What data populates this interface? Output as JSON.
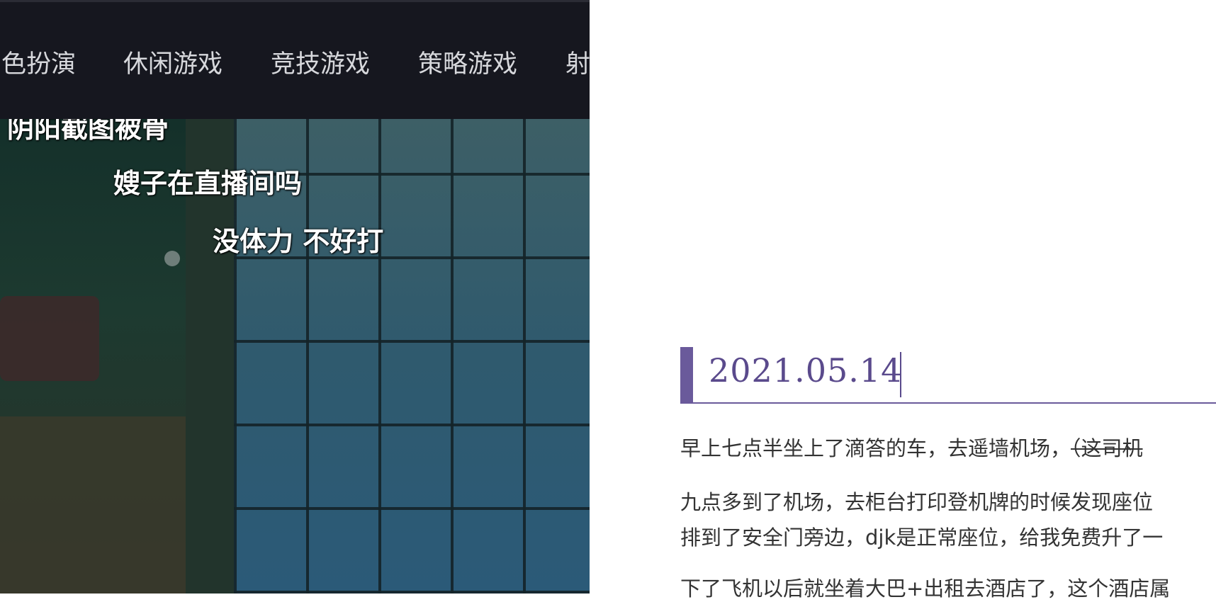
{
  "nav": {
    "items": [
      "色扮演",
      "休闲游戏",
      "竞技游戏",
      "策略游戏",
      "射"
    ]
  },
  "video": {
    "danmaku": [
      "阴阳截图被骨",
      "嫂子在直播间吗",
      "没体力 不好打"
    ]
  },
  "post": {
    "date": "2021.05.14",
    "paragraphs": {
      "p1_main": "早上七点半坐上了滴答的车，去遥墙机场，",
      "p1_strike": "（这司机",
      "p2_line1": "九点多到了机场，去柜台打印登机牌的时候发现座位",
      "p2_line2": "排到了安全门旁边，djk是正常座位，给我免费升了一",
      "p3_line1": "下了飞机以后就坐着大巴+出租去酒店了，这个酒店属"
    }
  },
  "colors": {
    "accent": "#6a5a9b",
    "nav_bg": "#16171f",
    "nav_text": "#d7d8dc",
    "body_text": "#333333"
  }
}
